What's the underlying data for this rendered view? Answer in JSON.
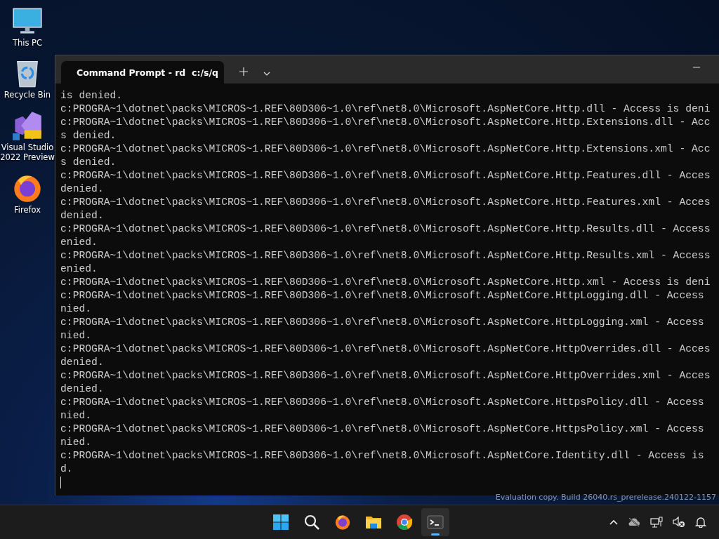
{
  "desktop_icons": [
    {
      "kind": "computer",
      "label": "This PC"
    },
    {
      "kind": "recycle-bin",
      "label": "Recycle Bin"
    },
    {
      "kind": "visual-studio",
      "label": "Visual Studio 2022 Preview"
    },
    {
      "kind": "firefox",
      "label": "Firefox"
    }
  ],
  "window": {
    "tab": {
      "title": "Command Prompt - rd  c:/s/q"
    },
    "lines": [
      "is denied.",
      "c:PROGRA~1\\dotnet\\packs\\MICROS~1.REF\\80D306~1.0\\ref\\net8.0\\Microsoft.AspNetCore.Http.dll - Access is deni",
      "c:PROGRA~1\\dotnet\\packs\\MICROS~1.REF\\80D306~1.0\\ref\\net8.0\\Microsoft.AspNetCore.Http.Extensions.dll - Acc",
      "s denied.",
      "c:PROGRA~1\\dotnet\\packs\\MICROS~1.REF\\80D306~1.0\\ref\\net8.0\\Microsoft.AspNetCore.Http.Extensions.xml - Acc",
      "s denied.",
      "c:PROGRA~1\\dotnet\\packs\\MICROS~1.REF\\80D306~1.0\\ref\\net8.0\\Microsoft.AspNetCore.Http.Features.dll - Acces",
      "denied.",
      "c:PROGRA~1\\dotnet\\packs\\MICROS~1.REF\\80D306~1.0\\ref\\net8.0\\Microsoft.AspNetCore.Http.Features.xml - Acces",
      "denied.",
      "c:PROGRA~1\\dotnet\\packs\\MICROS~1.REF\\80D306~1.0\\ref\\net8.0\\Microsoft.AspNetCore.Http.Results.dll - Access",
      "enied.",
      "c:PROGRA~1\\dotnet\\packs\\MICROS~1.REF\\80D306~1.0\\ref\\net8.0\\Microsoft.AspNetCore.Http.Results.xml - Access",
      "enied.",
      "c:PROGRA~1\\dotnet\\packs\\MICROS~1.REF\\80D306~1.0\\ref\\net8.0\\Microsoft.AspNetCore.Http.xml - Access is deni",
      "c:PROGRA~1\\dotnet\\packs\\MICROS~1.REF\\80D306~1.0\\ref\\net8.0\\Microsoft.AspNetCore.HttpLogging.dll - Access",
      "nied.",
      "c:PROGRA~1\\dotnet\\packs\\MICROS~1.REF\\80D306~1.0\\ref\\net8.0\\Microsoft.AspNetCore.HttpLogging.xml - Access",
      "nied.",
      "c:PROGRA~1\\dotnet\\packs\\MICROS~1.REF\\80D306~1.0\\ref\\net8.0\\Microsoft.AspNetCore.HttpOverrides.dll - Acces",
      "denied.",
      "c:PROGRA~1\\dotnet\\packs\\MICROS~1.REF\\80D306~1.0\\ref\\net8.0\\Microsoft.AspNetCore.HttpOverrides.xml - Acces",
      "denied.",
      "c:PROGRA~1\\dotnet\\packs\\MICROS~1.REF\\80D306~1.0\\ref\\net8.0\\Microsoft.AspNetCore.HttpsPolicy.dll - Access",
      "nied.",
      "c:PROGRA~1\\dotnet\\packs\\MICROS~1.REF\\80D306~1.0\\ref\\net8.0\\Microsoft.AspNetCore.HttpsPolicy.xml - Access",
      "nied.",
      "c:PROGRA~1\\dotnet\\packs\\MICROS~1.REF\\80D306~1.0\\ref\\net8.0\\Microsoft.AspNetCore.Identity.dll - Access is",
      "d."
    ]
  },
  "desktop_notice": "Evaluation copy. Build 26040.rs_prerelease.240122-1157",
  "taskbar": {
    "apps": [
      {
        "kind": "start",
        "selected": false
      },
      {
        "kind": "search",
        "selected": false
      },
      {
        "kind": "firefox",
        "selected": false
      },
      {
        "kind": "folder",
        "selected": false
      },
      {
        "kind": "chrome",
        "selected": false
      },
      {
        "kind": "terminal",
        "selected": true
      }
    ]
  }
}
